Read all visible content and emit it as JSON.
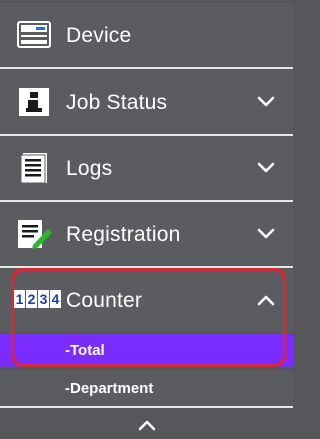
{
  "menu": {
    "device": {
      "label": "Device",
      "icon": "printer-icon"
    },
    "job_status": {
      "label": "Job Status",
      "icon": "info-icon",
      "expanded": false
    },
    "logs": {
      "label": "Logs",
      "icon": "document-icon",
      "expanded": false
    },
    "registration": {
      "label": "Registration",
      "icon": "registration-icon",
      "expanded": false
    },
    "counter": {
      "label": "Counter",
      "icon_digits": [
        "1",
        "2",
        "3",
        "4"
      ],
      "expanded": true,
      "subitems": [
        {
          "label": "-Total",
          "selected": true
        },
        {
          "label": "-Department",
          "selected": false
        }
      ]
    }
  },
  "colors": {
    "background": "#5b5c60",
    "selected": "#7b2cff",
    "highlight_border": "#e8212c",
    "divider": "#e6e6e6"
  }
}
